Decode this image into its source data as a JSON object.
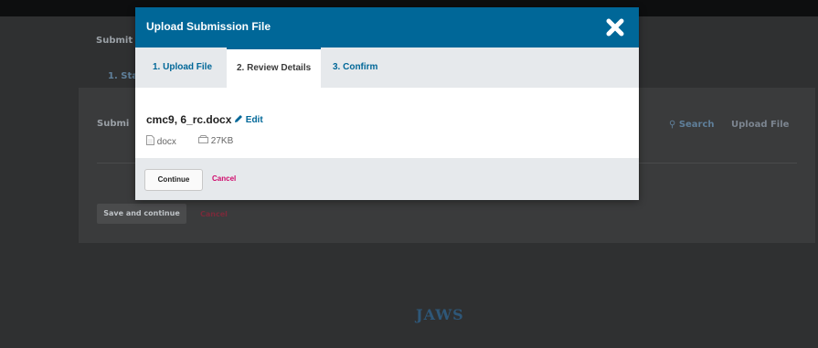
{
  "background": {
    "page_heading": "Submit",
    "step_link": "1. Star",
    "section_title": "Submi",
    "search_link": "Search",
    "upload_file_link": "Upload File",
    "save_button": "Save and continue",
    "cancel_link": "Cancel",
    "logo_text": "JAWS"
  },
  "modal": {
    "title": "Upload Submission File",
    "tabs": [
      {
        "label": "1. Upload File",
        "active": false
      },
      {
        "label": "2. Review Details",
        "active": true
      },
      {
        "label": "3. Confirm",
        "active": false
      }
    ],
    "file": {
      "name": "cmc9, 6_rc.docx",
      "edit_label": "Edit",
      "type": "docx",
      "size": "27KB"
    },
    "footer": {
      "continue_label": "Continue",
      "cancel_label": "Cancel"
    }
  },
  "colors": {
    "primary": "#006798",
    "cancel": "#d00a6c"
  }
}
